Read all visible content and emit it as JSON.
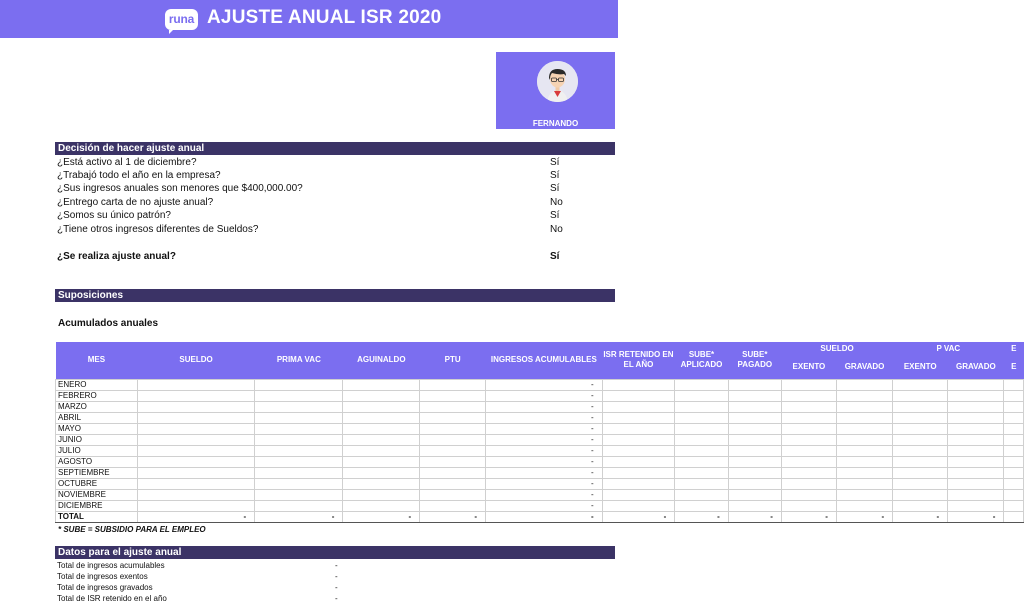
{
  "header": {
    "logo_text": "runa",
    "title": "AJUSTE ANUAL ISR 2020",
    "accent_color": "#7b6ef0"
  },
  "profile": {
    "name": "FERNANDO"
  },
  "decision": {
    "title": "Decisión de hacer ajuste anual",
    "questions": [
      {
        "q": "¿Está activo al 1 de diciembre?",
        "a": "Sí"
      },
      {
        "q": "¿Trabajó todo el año en la empresa?",
        "a": "Sí"
      },
      {
        "q": "¿Sus ingresos anuales son menores que $400,000.00?",
        "a": "Sí"
      },
      {
        "q": "¿Entrego carta de no ajuste anual?",
        "a": "No"
      },
      {
        "q": "¿Somos su único patrón?",
        "a": "Sí"
      },
      {
        "q": "¿Tiene otros ingresos diferentes de Sueldos?",
        "a": "No"
      }
    ],
    "result_q": "¿Se realiza ajuste anual?",
    "result_a": "Sí"
  },
  "suposiciones": {
    "title": "Suposiciones",
    "subtitle": "Acumulados anuales"
  },
  "table": {
    "headers": {
      "mes": "MES",
      "sueldo": "SUELDO",
      "prima_vac": "PRIMA VAC",
      "aguinaldo": "AGUINALDO",
      "ptu": "PTU",
      "ingresos_acum": "INGRESOS ACUMULABLES",
      "isr_retenido": "ISR RETENIDO EN EL AÑO",
      "sube_aplicado": "SUBE* APLICADO",
      "sube_pagado": "SUBE* PAGADO",
      "group_sueldo": "SUELDO",
      "group_pvac": "P VAC",
      "group_next": "E",
      "exento": "EXENTO",
      "gravado": "GRAVADO",
      "exento2": "EXENTO",
      "gravado2": "GRAVADO"
    },
    "months": [
      "ENERO",
      "FEBRERO",
      "MARZO",
      "ABRIL",
      "MAYO",
      "JUNIO",
      "JULIO",
      "AGOSTO",
      "SEPTIEMBRE",
      "OCTUBRE",
      "NOVIEMBRE",
      "DICIEMBRE"
    ],
    "month_value": "-",
    "total_label": "TOTAL",
    "total_values": [
      "-",
      "-",
      "-",
      "-",
      "-",
      "-",
      "-",
      "-",
      "-",
      "-",
      "-",
      "-"
    ]
  },
  "footnote": "* SUBE = SUBSIDIO PARA EL EMPLEO",
  "datos": {
    "title": "Datos para el ajuste anual",
    "rows": [
      {
        "label": "Total de ingresos acumulables",
        "value": "-"
      },
      {
        "label": "Total de ingresos exentos",
        "value": "-"
      },
      {
        "label": "Total de ingresos gravados",
        "value": "-"
      },
      {
        "label": "Total de ISR retenido en el año",
        "value": "-"
      }
    ]
  }
}
